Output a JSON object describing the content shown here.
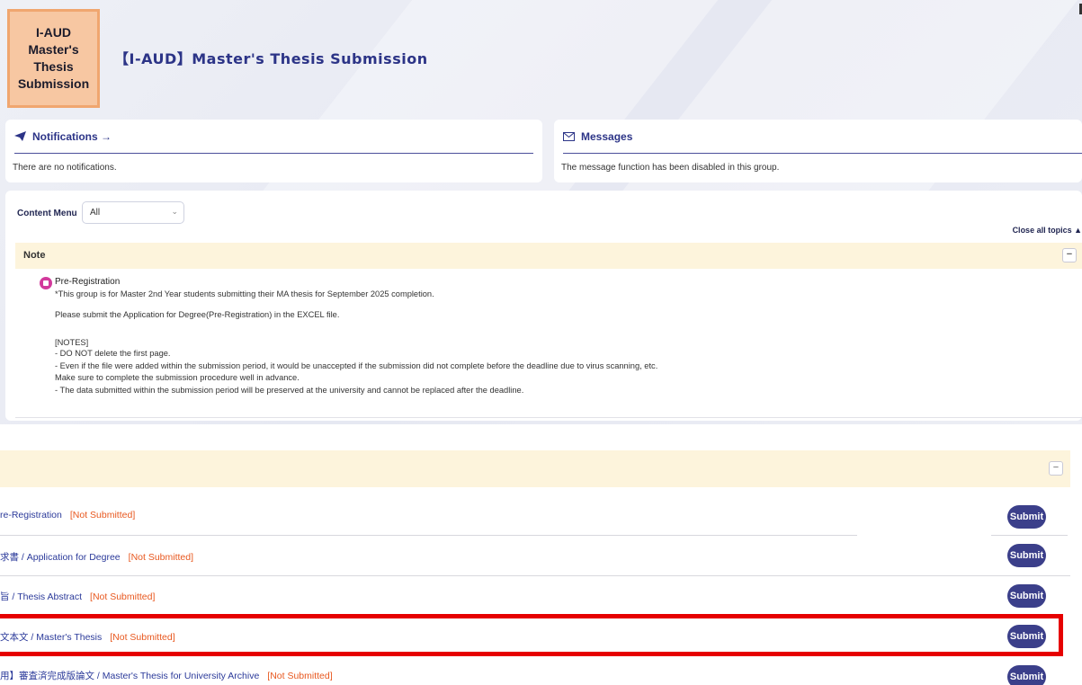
{
  "header": {
    "logo_text": "I-AUD\nMaster's\nThesis\nSubmission",
    "title": "【I-AUD】Master's Thesis Submission"
  },
  "notifications": {
    "heading": "Notifications →",
    "body": "There are no notifications."
  },
  "messages": {
    "heading": "Messages",
    "body": "The message function has been disabled in this group."
  },
  "content_menu": {
    "label": "Content Menu",
    "selected": "All",
    "close_all": "Close all topics ▲"
  },
  "note_section": {
    "title": "Note",
    "toggle": "−",
    "topic_title": "Pre-Registration",
    "lines": [
      "*This group is for Master 2nd Year students submitting their MA thesis for September 2025 completion.",
      "Please submit the Application for Degree(Pre-Registration) in the EXCEL file.",
      "[NOTES]",
      "- DO NOT delete the first page.",
      "- Even if the file were added within the submission period, it would be unaccepted if the submission did not complete before the deadline due to virus scanning, etc.",
      "Make sure to complete the submission procedure well in advance.",
      "- The data submitted within the submission period will be preserved at the university and cannot be replaced after the deadline."
    ]
  },
  "submission_section": {
    "toggle": "−",
    "rows": [
      {
        "label": "re-Registration",
        "status": "[Not Submitted]",
        "button": "Submit"
      },
      {
        "label": "求書 / Application for Degree",
        "status": "[Not Submitted]",
        "button": "Submit"
      },
      {
        "label": "旨 / Thesis Abstract",
        "status": "[Not Submitted]",
        "button": "Submit"
      },
      {
        "label": "文本文 / Master's Thesis",
        "status": "[Not Submitted]",
        "button": "Submit"
      },
      {
        "label": "用】審査済完成版論文 / Master's Thesis for University Archive",
        "status": "[Not Submitted]",
        "button": "Submit"
      }
    ]
  },
  "colors": {
    "accent": "#2c3487",
    "status": "#e8581f",
    "button": "#3b3f8a",
    "highlight": "#e60000",
    "section_bg": "#fdf4dc"
  }
}
